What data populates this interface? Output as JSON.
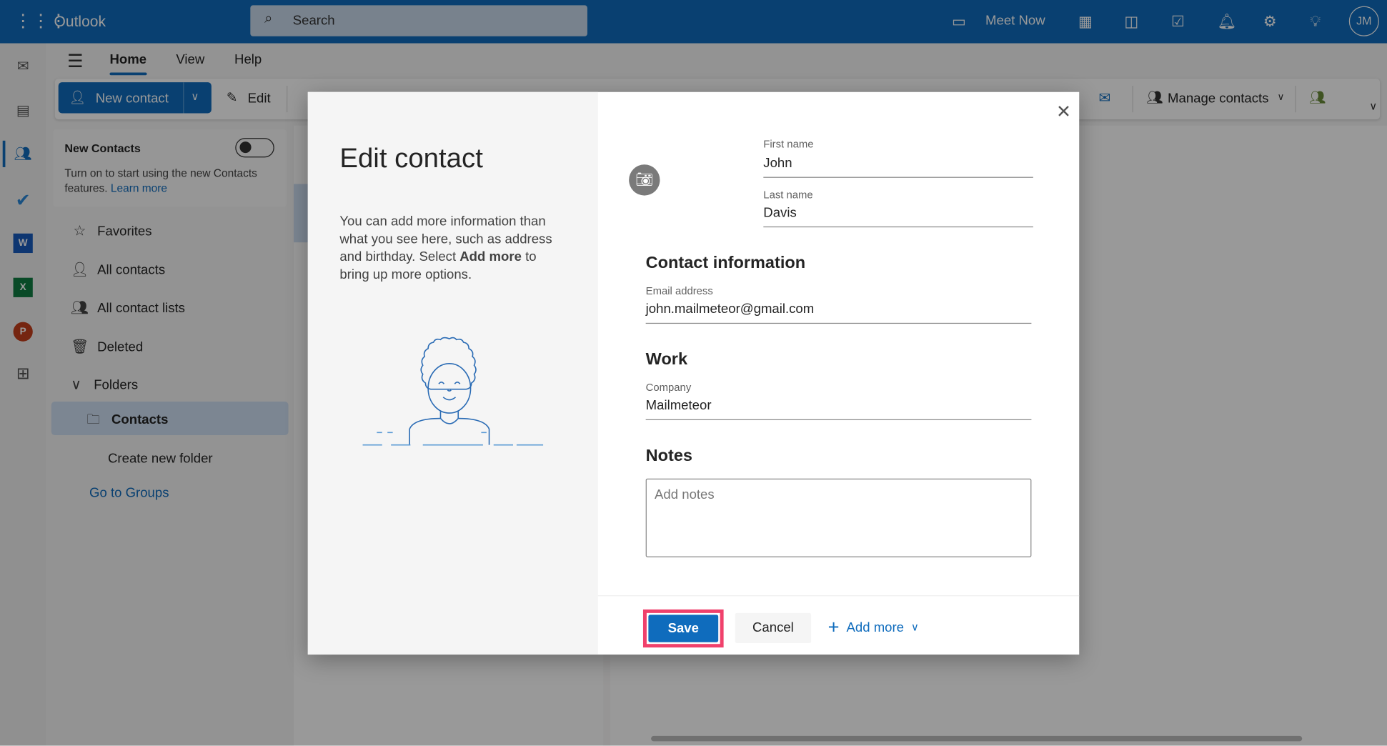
{
  "topbar": {
    "app_name": "Outlook",
    "search_placeholder": "Search",
    "meet_now": "Meet Now",
    "avatar_initials": "JM"
  },
  "ribbon": {
    "tabs": [
      "Home",
      "View",
      "Help"
    ],
    "active_tab": "Home",
    "new_contact": "New contact",
    "edit": "Edit",
    "manage_contacts": "Manage contacts"
  },
  "sidebar": {
    "new_contacts_title": "New Contacts",
    "new_contacts_toggle": false,
    "new_contacts_desc": "Turn on to start using the new Contacts features.",
    "learn_more": "Learn more",
    "items": [
      {
        "label": "Favorites",
        "icon": "star-icon"
      },
      {
        "label": "All contacts",
        "icon": "person-icon"
      },
      {
        "label": "All contact lists",
        "icon": "people-list-icon"
      },
      {
        "label": "Deleted",
        "icon": "trash-icon"
      }
    ],
    "folders_label": "Folders",
    "contacts_folder": "Contacts",
    "create_folder": "Create new folder",
    "go_to_groups": "Go to Groups"
  },
  "dialog": {
    "title": "Edit contact",
    "desc_before": "You can add more information than what you see here, such as address and birthday. Select ",
    "desc_bold": "Add more",
    "desc_after": " to bring up more options.",
    "first_name_label": "First name",
    "first_name": "John",
    "last_name_label": "Last name",
    "last_name": "Davis",
    "contact_info_heading": "Contact information",
    "email_label": "Email address",
    "email": "john.mailmeteor@gmail.com",
    "work_heading": "Work",
    "company_label": "Company",
    "company": "Mailmeteor",
    "notes_heading": "Notes",
    "notes_placeholder": "Add notes",
    "notes": "",
    "save": "Save",
    "cancel": "Cancel",
    "add_more": "Add more"
  },
  "colors": {
    "brand": "#0f6cbd",
    "highlight": "#f0416c"
  }
}
